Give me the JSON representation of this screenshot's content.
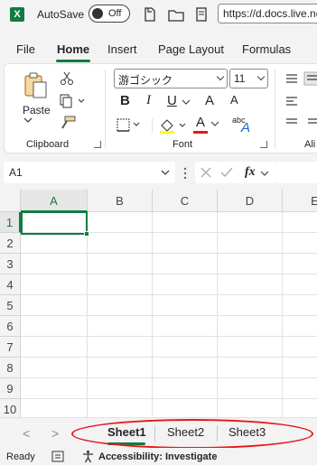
{
  "titlebar": {
    "autosave_label": "AutoSave",
    "autosave_state": "Off",
    "url": "https://d.docs.live.ne"
  },
  "menu": {
    "tabs": [
      "File",
      "Home",
      "Insert",
      "Page Layout",
      "Formulas"
    ],
    "active": "Home"
  },
  "ribbon": {
    "paste_label": "Paste",
    "clipboard_label": "Clipboard",
    "font_label": "Font",
    "alignment_label": "Ali",
    "font_name": "游ゴシック",
    "font_size": "11",
    "bold": "B",
    "italic": "I",
    "underline": "U",
    "grow_font": "A",
    "shrink_font": "A",
    "font_color": "A",
    "phonetic": "abc"
  },
  "formula_bar": {
    "name_box": "A1",
    "fx": "fx"
  },
  "grid": {
    "columns": [
      "A",
      "B",
      "C",
      "D",
      "E"
    ],
    "rows": [
      "1",
      "2",
      "3",
      "4",
      "5",
      "6",
      "7",
      "8",
      "9",
      "10"
    ],
    "selected_cell": "A1"
  },
  "sheets": {
    "tabs": [
      "Sheet1",
      "Sheet2",
      "Sheet3"
    ],
    "active": "Sheet1",
    "prev": "<",
    "next": ">"
  },
  "status": {
    "ready": "Ready",
    "accessibility": "Accessibility: Investigate"
  },
  "colors": {
    "accent": "#107c41",
    "annotation": "#e8161b"
  }
}
